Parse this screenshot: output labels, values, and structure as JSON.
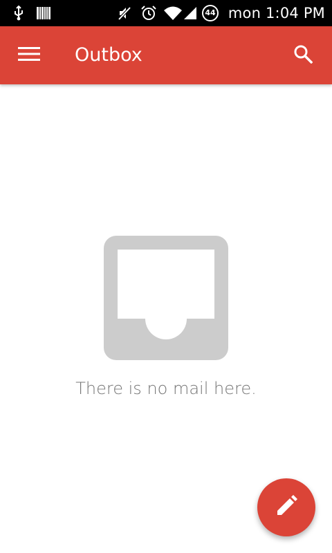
{
  "status_bar": {
    "time": "mon 1:04 PM",
    "battery_level": "44",
    "icons": [
      "usb-icon",
      "barcode-icon",
      "mute-icon",
      "alarm-icon",
      "wifi-icon",
      "signal-icon",
      "battery-icon"
    ]
  },
  "app_bar": {
    "title": "Outbox",
    "menu_icon": "menu-icon",
    "search_icon": "search-icon",
    "color": "#DB4437"
  },
  "empty_state": {
    "icon": "empty-inbox-icon",
    "message": "There is no mail here."
  },
  "fab": {
    "icon": "pencil-icon",
    "color": "#DB4437"
  }
}
